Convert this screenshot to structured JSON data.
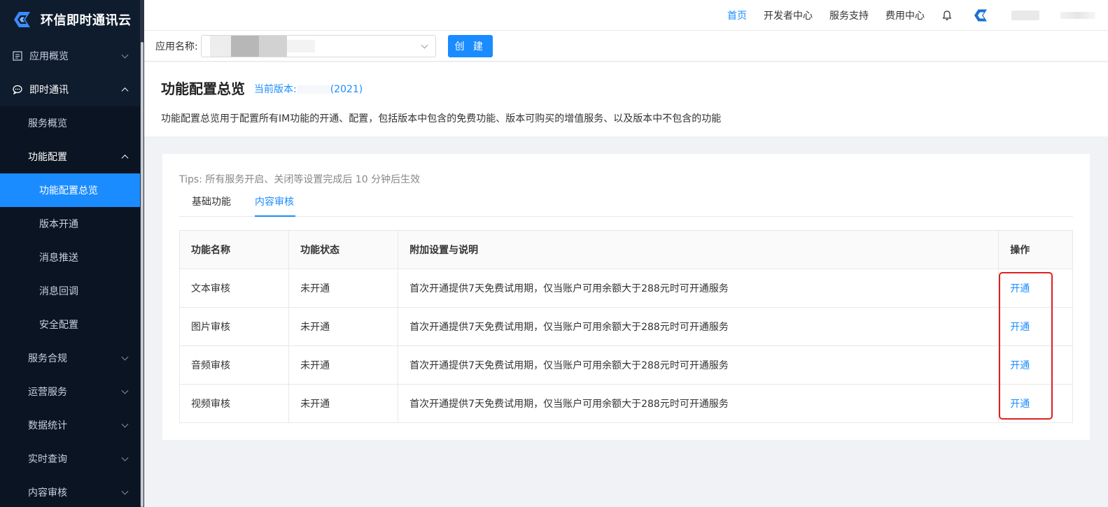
{
  "brand": {
    "title": "环信即时通讯云"
  },
  "sidebar": {
    "items": [
      {
        "label": "应用概览"
      },
      {
        "label": "即时通讯"
      },
      {
        "label": "服务概览"
      },
      {
        "label": "功能配置"
      },
      {
        "label": "功能配置总览"
      },
      {
        "label": "版本开通"
      },
      {
        "label": "消息推送"
      },
      {
        "label": "消息回调"
      },
      {
        "label": "安全配置"
      },
      {
        "label": "服务合规"
      },
      {
        "label": "运营服务"
      },
      {
        "label": "数据统计"
      },
      {
        "label": "实时查询"
      },
      {
        "label": "内容审核"
      }
    ]
  },
  "topnav": {
    "home": "首页",
    "dev": "开发者中心",
    "support": "服务支持",
    "billing": "费用中心"
  },
  "app": {
    "label": "应用名称:",
    "create": "创 建"
  },
  "page": {
    "title": "功能配置总览",
    "version_prefix": "当前版本:",
    "version_suffix": "(2021)",
    "description": "功能配置总览用于配置所有IM功能的开通、配置，包括版本中包含的免费功能、版本可购买的增值服务、以及版本中不包含的功能"
  },
  "card": {
    "tips": "Tips: 所有服务开启、关闭等设置完成后 10 分钟后生效",
    "tabs": [
      "基础功能",
      "内容审核"
    ],
    "headers": [
      "功能名称",
      "功能状态",
      "附加设置与说明",
      "操作"
    ],
    "rows": [
      {
        "name": "文本审核",
        "status": "未开通",
        "note": "首次开通提供7天免费试用期，仅当账户可用余额大于288元时可开通服务",
        "action": "开通"
      },
      {
        "name": "图片审核",
        "status": "未开通",
        "note": "首次开通提供7天免费试用期，仅当账户可用余额大于288元时可开通服务",
        "action": "开通"
      },
      {
        "name": "音频审核",
        "status": "未开通",
        "note": "首次开通提供7天免费试用期，仅当账户可用余额大于288元时可开通服务",
        "action": "开通"
      },
      {
        "name": "视频审核",
        "status": "未开通",
        "note": "首次开通提供7天免费试用期，仅当账户可用余额大于288元时可开通服务",
        "action": "开通"
      }
    ]
  },
  "colors": {
    "accent": "#1a8cff",
    "sidebar": "#0f1c2e",
    "highlight": "#e02020"
  }
}
